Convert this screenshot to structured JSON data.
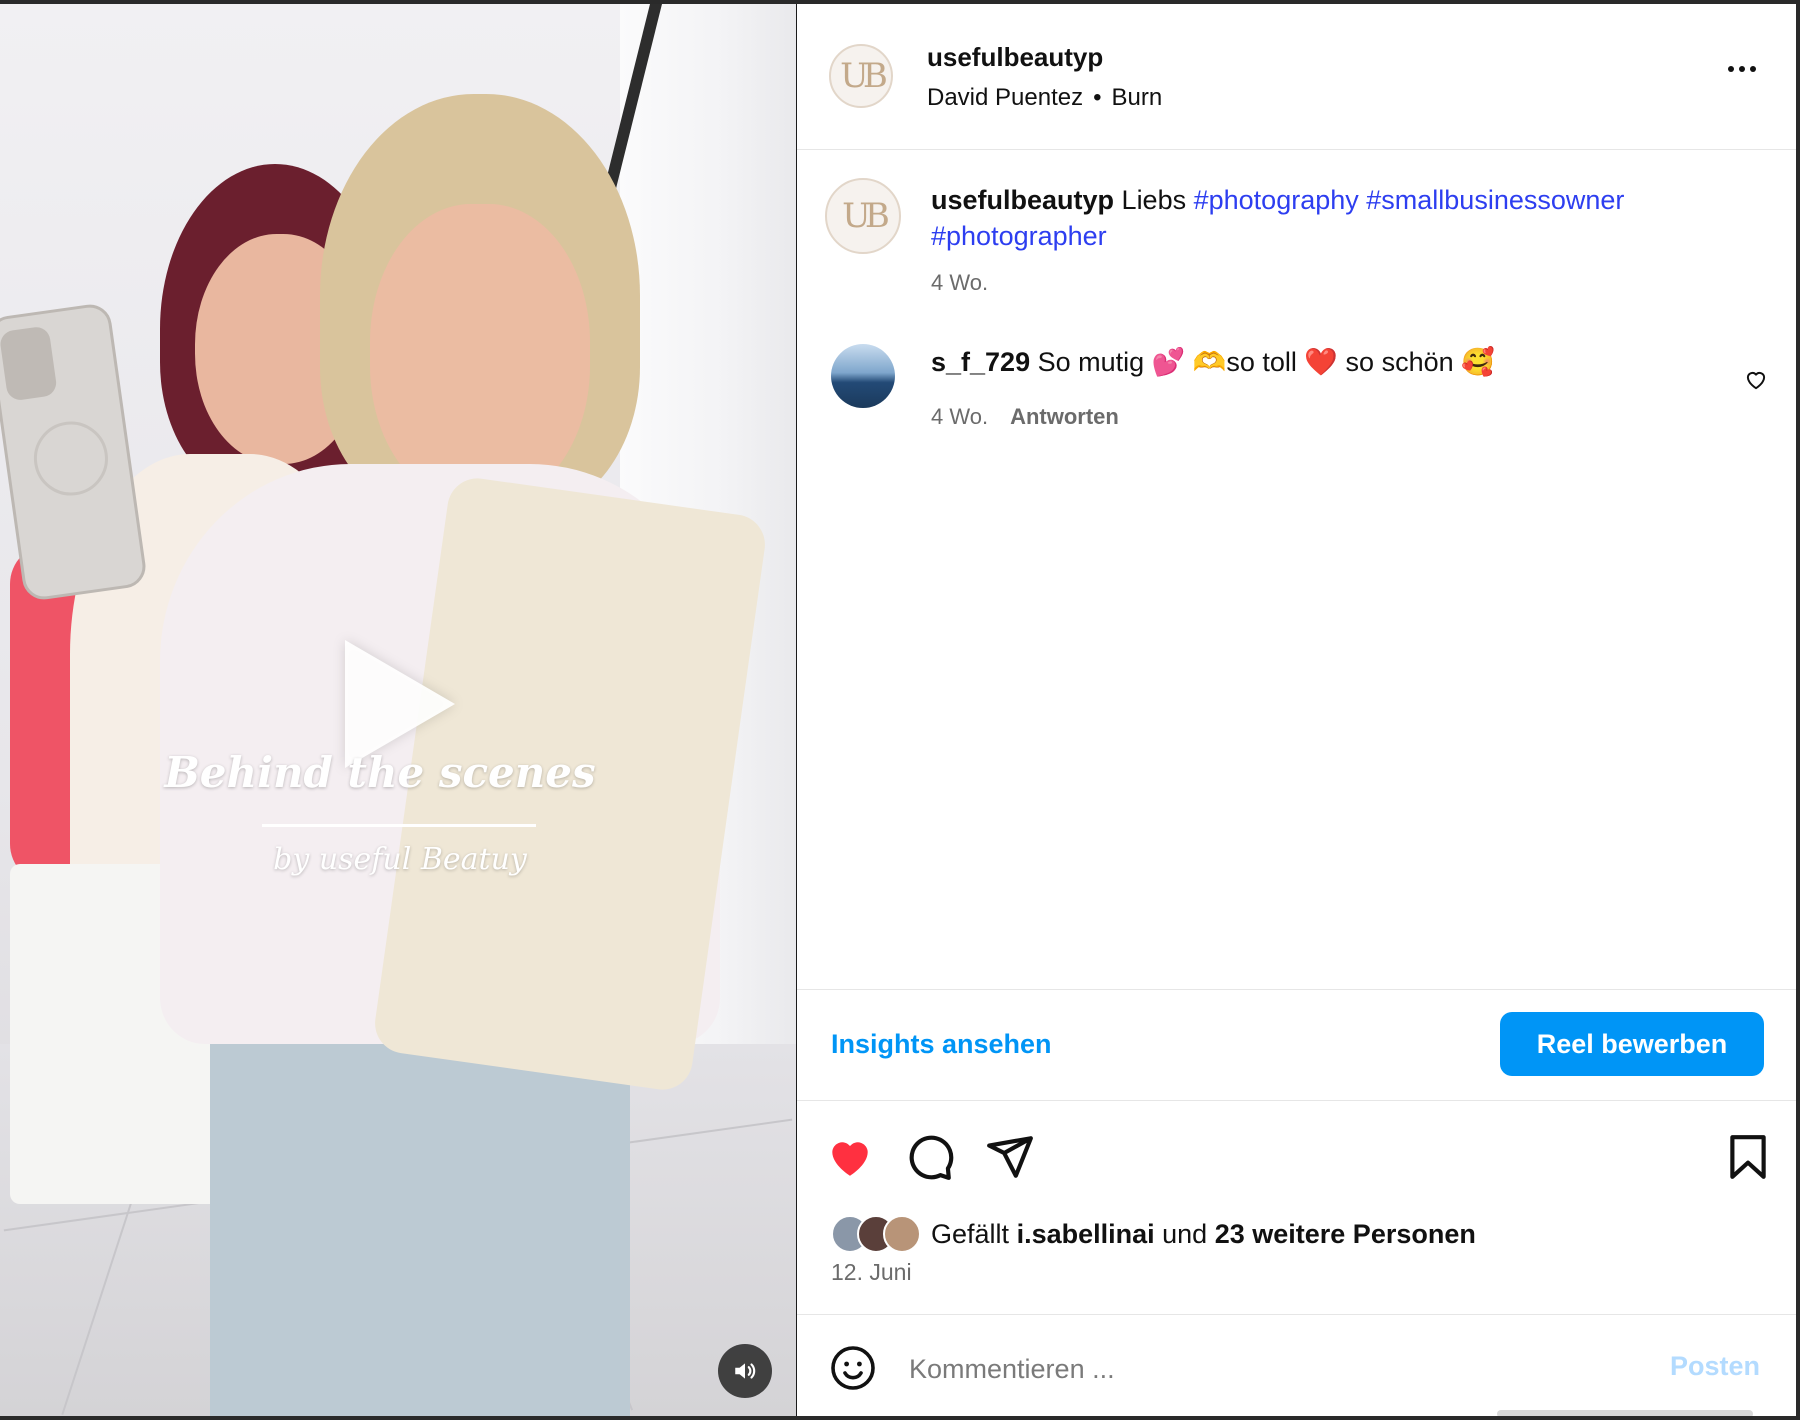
{
  "video": {
    "overlay_title": "Behind the scenes",
    "overlay_subtitle": "by useful Beatuy",
    "play_icon": "play-icon",
    "sound_icon": "speaker-icon"
  },
  "header": {
    "avatar_monogram": "UB",
    "username": "usefulbeautyp",
    "audio_artist": "David Puentez",
    "audio_separator": "•",
    "audio_track": "Burn",
    "more_icon": "more-horizontal-icon"
  },
  "caption": {
    "username": "usefulbeautyp",
    "text": "Liebs",
    "hashtags": [
      "#photography",
      "#smallbusinessowner",
      "#photographer"
    ],
    "time": "4 Wo."
  },
  "comments": [
    {
      "username": "s_f_729",
      "text": "So mutig 💕 🫶so toll ❤️ so schön 🥰",
      "time": "4 Wo.",
      "reply_label": "Antworten"
    }
  ],
  "promo": {
    "insights_label": "Insights ansehen",
    "promote_label": "Reel bewerben"
  },
  "actions": {
    "like_icon": "heart-filled-icon",
    "comment_icon": "comment-icon",
    "share_icon": "send-icon",
    "save_icon": "bookmark-icon"
  },
  "likes": {
    "prefix": "Gefällt",
    "user": "i.sabellinai",
    "middle": "und",
    "others": "23 weitere Personen"
  },
  "post_date": "12. Juni",
  "comment_box": {
    "placeholder": "Kommentieren ...",
    "post_label": "Posten"
  },
  "colors": {
    "accent": "#0095f6",
    "hashtag": "#2d3ef0",
    "like": "#ff3040",
    "post_disabled": "#b3dbff"
  }
}
